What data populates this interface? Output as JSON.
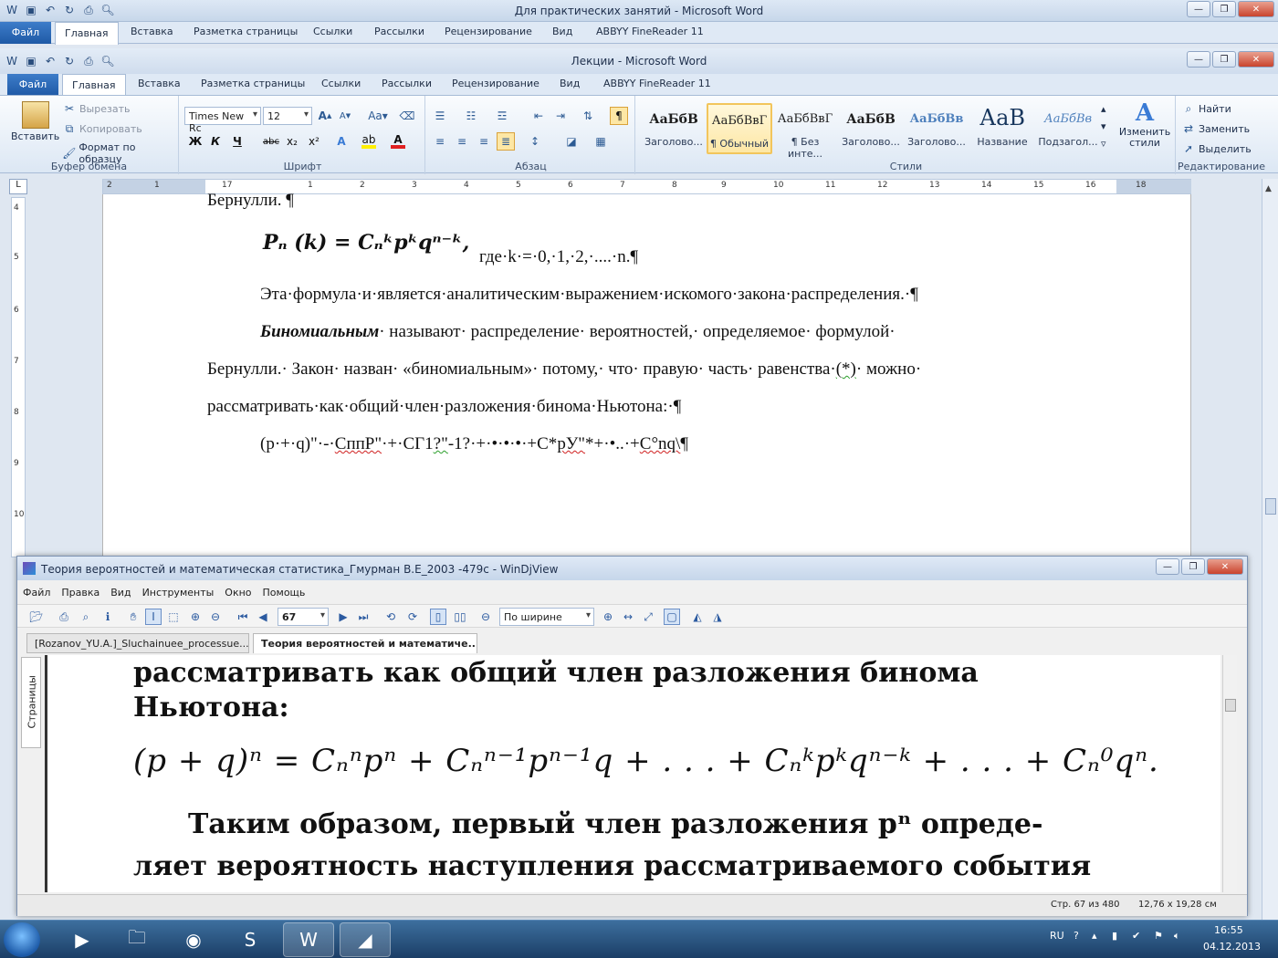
{
  "outer_word": {
    "title": "Для практических занятий  -  Microsoft Word",
    "tabs": [
      "Файл",
      "Главная",
      "Вставка",
      "Разметка страницы",
      "Ссылки",
      "Рассылки",
      "Рецензирование",
      "Вид",
      "ABBYY FineReader 11"
    ]
  },
  "inner_word": {
    "title": "Лекции  -  Microsoft Word",
    "tabs": [
      "Файл",
      "Главная",
      "Вставка",
      "Разметка страницы",
      "Ссылки",
      "Рассылки",
      "Рецензирование",
      "Вид",
      "ABBYY FineReader 11"
    ]
  },
  "ribbon": {
    "clipboard": {
      "paste": "Вставить",
      "cut": "Вырезать",
      "copy": "Копировать",
      "format_painter": "Формат по образцу",
      "label": "Буфер обмена"
    },
    "font": {
      "font_name": "Times New Rc",
      "font_size": "12",
      "label": "Шрифт"
    },
    "paragraph": {
      "label": "Абзац"
    },
    "styles": {
      "label": "Стили",
      "items": [
        {
          "sample": "АаБбВ",
          "name": "Заголово..."
        },
        {
          "sample": "АаБбВвГ",
          "name": "¶ Обычный"
        },
        {
          "sample": "АаБбВвГ",
          "name": "¶ Без инте..."
        },
        {
          "sample": "АаБбВ",
          "name": "Заголово..."
        },
        {
          "sample": "АаБбВв",
          "name": "Заголово..."
        },
        {
          "sample": "АаВ",
          "name": "Название"
        },
        {
          "sample": "АаБбВв",
          "name": "Подзагол..."
        }
      ],
      "change_styles": "Изменить стили"
    },
    "editing": {
      "find": "Найти",
      "replace": "Заменить",
      "select": "Выделить",
      "label": "Редактирование"
    }
  },
  "ruler": {
    "h_ticks": [
      "2",
      "1",
      "1",
      "2",
      "3",
      "4",
      "5",
      "6",
      "7",
      "8",
      "9",
      "10",
      "11",
      "12",
      "13",
      "14",
      "15",
      "16",
      "17",
      "18"
    ],
    "v_ticks": [
      "4",
      "5",
      "6",
      "7",
      "8",
      "9",
      "10"
    ],
    "right_ticks": [
      "6",
      "7",
      "8",
      "9",
      "10",
      "11",
      "12",
      "13",
      "14",
      "15"
    ]
  },
  "document": {
    "line0": "Бернулли. ¶",
    "formula": "Pₙ (k) = Cₙᵏpᵏqⁿ⁻ᵏ,",
    "formula_tail": "где·k·=·0,·1,·2,·....·n.¶",
    "p1": "Эта·формула·и·является·аналитическим·выражением·искомого·закона·распределения.·¶",
    "p2_italic": "Биномиальным",
    "p2_rest": "·  называют·  распределение·  вероятностей,·  определяемое·  формулой·",
    "p3": "Бернулли.· Закон· назван· «биномиальным»· потому,· что· правую· часть· равенства·",
    "p3_marked": "(*)",
    "p3_end": "· можно·",
    "p4": "рассматривать·как·общий·член·разложения·бинома·Ньютона:·¶",
    "p5_a": "(р·+·q)\"·-·",
    "p5_b": "СппР\"",
    "p5_c": "·+·СГ1",
    "p5_d": "?\"",
    "p5_e": "-1?·+·•·•·•·+С*",
    "p5_f": "рУ\"",
    "p5_g": "*+·•..·+",
    "p5_h": "C°nq\\",
    "p5_i": "¶"
  },
  "windjview": {
    "title": "Теория вероятностей и математическая статистика_Гмурман В.Е_2003 -479с - WinDjView",
    "menu": [
      "Файл",
      "Правка",
      "Вид",
      "Инструменты",
      "Окно",
      "Помощь"
    ],
    "page_field": "67",
    "zoom": "По ширине",
    "tabs": [
      "[Rozanov_YU.A.]_Sluchainuee_processue....",
      "Теория вероятностей и математиче..."
    ],
    "side_tab": "Страницы",
    "scan_lines": {
      "l1": "рассматривать   как   общий   член   разложения   бинома",
      "l2": "Ньютона:",
      "formula": "(p + q)ⁿ = Cₙⁿpⁿ + Cₙⁿ⁻¹pⁿ⁻¹q + . . . + Cₙᵏpᵏqⁿ⁻ᵏ + . . . + Cₙ⁰qⁿ.",
      "l3": "Таким  образом,   первый   член   разложения  pⁿ  опреде-",
      "l4": "ляет  вероятность  наступления  рассматриваемого  события"
    },
    "status_page": "Стр. 67 из 480",
    "status_size": "12,76 x 19,28 см"
  },
  "taskbar": {
    "lang": "RU",
    "time": "16:55",
    "date": "04.12.2013"
  }
}
